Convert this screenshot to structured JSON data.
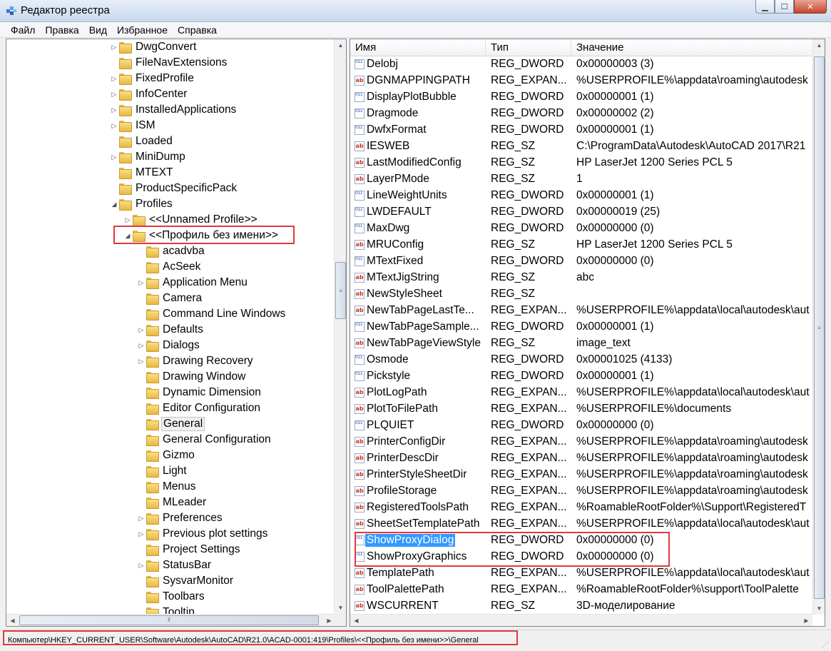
{
  "window": {
    "title": "Редактор реестра",
    "minimize_icon": "minimize-icon",
    "maximize_icon": "maximize-icon",
    "close_icon": "close-icon"
  },
  "menu": [
    "Файл",
    "Правка",
    "Вид",
    "Избранное",
    "Справка"
  ],
  "tree": {
    "items": [
      {
        "label": "DwgConvert",
        "expander": "▷"
      },
      {
        "label": "FileNavExtensions",
        "expander": ""
      },
      {
        "label": "FixedProfile",
        "expander": "▷"
      },
      {
        "label": "InfoCenter",
        "expander": "▷"
      },
      {
        "label": "InstalledApplications",
        "expander": "▷"
      },
      {
        "label": "ISM",
        "expander": "▷"
      },
      {
        "label": "Loaded",
        "expander": ""
      },
      {
        "label": "MiniDump",
        "expander": "▷"
      },
      {
        "label": "MTEXT",
        "expander": ""
      },
      {
        "label": "ProductSpecificPack",
        "expander": ""
      },
      {
        "label": "Profiles",
        "expander": "◢"
      },
      {
        "label": "<<Unnamed Profile>>",
        "expander": "▷"
      },
      {
        "label": "<<Профиль без имени>>",
        "expander": "◢"
      },
      {
        "label": "acadvba",
        "expander": ""
      },
      {
        "label": "AcSeek",
        "expander": ""
      },
      {
        "label": "Application Menu",
        "expander": "▷"
      },
      {
        "label": "Camera",
        "expander": ""
      },
      {
        "label": "Command Line Windows",
        "expander": ""
      },
      {
        "label": "Defaults",
        "expander": "▷"
      },
      {
        "label": "Dialogs",
        "expander": "▷"
      },
      {
        "label": "Drawing Recovery",
        "expander": "▷"
      },
      {
        "label": "Drawing Window",
        "expander": ""
      },
      {
        "label": "Dynamic Dimension",
        "expander": ""
      },
      {
        "label": "Editor Configuration",
        "expander": ""
      },
      {
        "label": "General",
        "expander": ""
      },
      {
        "label": "General Configuration",
        "expander": ""
      },
      {
        "label": "Gizmo",
        "expander": ""
      },
      {
        "label": "Light",
        "expander": ""
      },
      {
        "label": "Menus",
        "expander": ""
      },
      {
        "label": "MLeader",
        "expander": ""
      },
      {
        "label": "Preferences",
        "expander": "▷"
      },
      {
        "label": "Previous plot settings",
        "expander": "▷"
      },
      {
        "label": "Project Settings",
        "expander": ""
      },
      {
        "label": "StatusBar",
        "expander": "▷"
      },
      {
        "label": "SysvarMonitor",
        "expander": ""
      },
      {
        "label": "Toolbars",
        "expander": ""
      },
      {
        "label": "Tooltip",
        "expander": ""
      }
    ]
  },
  "list": {
    "headers": {
      "name": "Имя",
      "type": "Тип",
      "value": "Значение"
    },
    "rows": [
      {
        "name": "Delobj",
        "type": "REG_DWORD",
        "value": "0x00000003 (3)",
        "icon": "dword"
      },
      {
        "name": "DGNMAPPINGPATH",
        "type": "REG_EXPAN...",
        "value": "%USERPROFILE%\\appdata\\roaming\\autodesk",
        "icon": "sz"
      },
      {
        "name": "DisplayPlotBubble",
        "type": "REG_DWORD",
        "value": "0x00000001 (1)",
        "icon": "dword"
      },
      {
        "name": "Dragmode",
        "type": "REG_DWORD",
        "value": "0x00000002 (2)",
        "icon": "dword"
      },
      {
        "name": "DwfxFormat",
        "type": "REG_DWORD",
        "value": "0x00000001 (1)",
        "icon": "dword"
      },
      {
        "name": "IESWEB",
        "type": "REG_SZ",
        "value": "C:\\ProgramData\\Autodesk\\AutoCAD 2017\\R21",
        "icon": "sz"
      },
      {
        "name": "LastModifiedConfig",
        "type": "REG_SZ",
        "value": "HP LaserJet 1200 Series PCL 5",
        "icon": "sz"
      },
      {
        "name": "LayerPMode",
        "type": "REG_SZ",
        "value": "1",
        "icon": "sz"
      },
      {
        "name": "LineWeightUnits",
        "type": "REG_DWORD",
        "value": "0x00000001 (1)",
        "icon": "dword"
      },
      {
        "name": "LWDEFAULT",
        "type": "REG_DWORD",
        "value": "0x00000019 (25)",
        "icon": "dword"
      },
      {
        "name": "MaxDwg",
        "type": "REG_DWORD",
        "value": "0x00000000 (0)",
        "icon": "dword"
      },
      {
        "name": "MRUConfig",
        "type": "REG_SZ",
        "value": "HP LaserJet 1200 Series PCL 5",
        "icon": "sz"
      },
      {
        "name": "MTextFixed",
        "type": "REG_DWORD",
        "value": "0x00000000 (0)",
        "icon": "dword"
      },
      {
        "name": "MTextJigString",
        "type": "REG_SZ",
        "value": "abc",
        "icon": "sz"
      },
      {
        "name": "NewStyleSheet",
        "type": "REG_SZ",
        "value": "",
        "icon": "sz"
      },
      {
        "name": "NewTabPageLastTe...",
        "type": "REG_EXPAN...",
        "value": "%USERPROFILE%\\appdata\\local\\autodesk\\aut",
        "icon": "sz"
      },
      {
        "name": "NewTabPageSample...",
        "type": "REG_DWORD",
        "value": "0x00000001 (1)",
        "icon": "dword"
      },
      {
        "name": "NewTabPageViewStyle",
        "type": "REG_SZ",
        "value": "image_text",
        "icon": "sz"
      },
      {
        "name": "Osmode",
        "type": "REG_DWORD",
        "value": "0x00001025 (4133)",
        "icon": "dword"
      },
      {
        "name": "Pickstyle",
        "type": "REG_DWORD",
        "value": "0x00000001 (1)",
        "icon": "dword"
      },
      {
        "name": "PlotLogPath",
        "type": "REG_EXPAN...",
        "value": "%USERPROFILE%\\appdata\\local\\autodesk\\aut",
        "icon": "sz"
      },
      {
        "name": "PlotToFilePath",
        "type": "REG_EXPAN...",
        "value": "%USERPROFILE%\\documents",
        "icon": "sz"
      },
      {
        "name": "PLQUIET",
        "type": "REG_DWORD",
        "value": "0x00000000 (0)",
        "icon": "dword"
      },
      {
        "name": "PrinterConfigDir",
        "type": "REG_EXPAN...",
        "value": "%USERPROFILE%\\appdata\\roaming\\autodesk",
        "icon": "sz"
      },
      {
        "name": "PrinterDescDir",
        "type": "REG_EXPAN...",
        "value": "%USERPROFILE%\\appdata\\roaming\\autodesk",
        "icon": "sz"
      },
      {
        "name": "PrinterStyleSheetDir",
        "type": "REG_EXPAN...",
        "value": "%USERPROFILE%\\appdata\\roaming\\autodesk",
        "icon": "sz"
      },
      {
        "name": "ProfileStorage",
        "type": "REG_EXPAN...",
        "value": "%USERPROFILE%\\appdata\\roaming\\autodesk",
        "icon": "sz"
      },
      {
        "name": "RegisteredToolsPath",
        "type": "REG_EXPAN...",
        "value": "%RoamableRootFolder%\\Support\\RegisteredT",
        "icon": "sz"
      },
      {
        "name": "SheetSetTemplatePath",
        "type": "REG_EXPAN...",
        "value": "%USERPROFILE%\\appdata\\local\\autodesk\\aut",
        "icon": "sz"
      },
      {
        "name": "ShowProxyDialog",
        "type": "REG_DWORD",
        "value": "0x00000000 (0)",
        "icon": "dword"
      },
      {
        "name": "ShowProxyGraphics",
        "type": "REG_DWORD",
        "value": "0x00000000 (0)",
        "icon": "dword"
      },
      {
        "name": "TemplatePath",
        "type": "REG_EXPAN...",
        "value": "%USERPROFILE%\\appdata\\local\\autodesk\\aut",
        "icon": "sz"
      },
      {
        "name": "ToolPalettePath",
        "type": "REG_EXPAN...",
        "value": "%RoamableRootFolder%\\support\\ToolPalette",
        "icon": "sz"
      },
      {
        "name": "WSCURRENT",
        "type": "REG_SZ",
        "value": "3D-моделирование",
        "icon": "sz"
      }
    ]
  },
  "status": {
    "path": "Компьютер\\HKEY_CURRENT_USER\\Software\\Autodesk\\AutoCAD\\R21.0\\ACAD-0001:419\\Profiles\\<<Профиль без имени>>\\General"
  },
  "colors": {
    "highlight": "#e0393e",
    "selection": "#3399ff"
  }
}
